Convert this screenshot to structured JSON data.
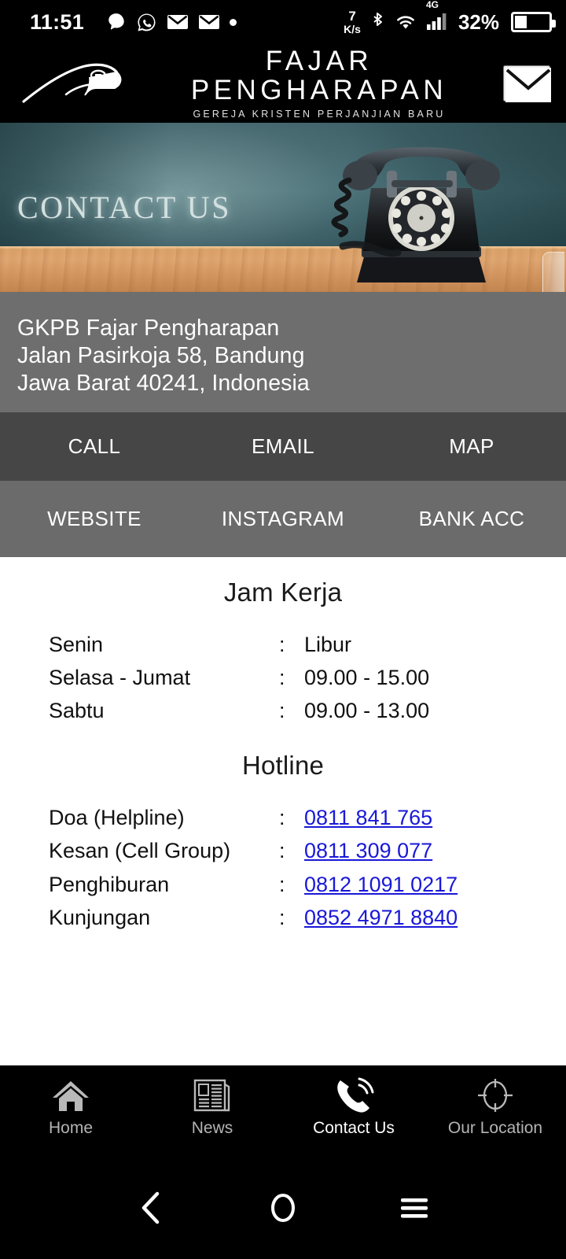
{
  "status_bar": {
    "time": "11:51",
    "icons_left": [
      "chat-bubble-icon",
      "whatsapp-icon",
      "mail-icon",
      "mail-icon",
      "dot-icon"
    ],
    "net_speed_value": "7",
    "net_speed_unit": "K/s",
    "icons_right": [
      "bluetooth-icon",
      "wifi-icon"
    ],
    "mobile_network": "4G",
    "battery_percent": "32%"
  },
  "header": {
    "logo": "eagle-logo",
    "title": "FAJAR PENGHARAPAN",
    "subtitle": "GEREJA KRISTEN PERJANJIAN BARU",
    "mail_icon": "envelope-icon"
  },
  "hero": {
    "title": "CONTACT US",
    "image": "vintage-rotary-telephone-on-wooden-table"
  },
  "address": {
    "line1": "GKPB Fajar Pengharapan",
    "line2": "Jalan Pasirkoja 58, Bandung",
    "line3": "Jawa Barat 40241, Indonesia"
  },
  "actions": {
    "row1": [
      {
        "label": "CALL",
        "name": "call-button"
      },
      {
        "label": "EMAIL",
        "name": "email-button"
      },
      {
        "label": "MAP",
        "name": "map-button"
      }
    ],
    "row2": [
      {
        "label": "WEBSITE",
        "name": "website-button"
      },
      {
        "label": "INSTAGRAM",
        "name": "instagram-button"
      },
      {
        "label": "BANK ACC",
        "name": "bank-acc-button"
      }
    ]
  },
  "working_hours": {
    "title": "Jam Kerja",
    "separator": ":",
    "rows": [
      {
        "day": "Senin",
        "hours": "Libur"
      },
      {
        "day": "Selasa - Jumat",
        "hours": "09.00 - 15.00"
      },
      {
        "day": "Sabtu",
        "hours": "09.00 - 13.00"
      }
    ]
  },
  "hotline": {
    "title": "Hotline",
    "separator": ":",
    "rows": [
      {
        "label": "Doa (Helpline)",
        "number": "0811 841 765"
      },
      {
        "label": "Kesan (Cell Group)",
        "number": "0811 309 077"
      },
      {
        "label": "Penghiburan",
        "number": "0812 1091 0217"
      },
      {
        "label": "Kunjungan",
        "number": "0852 4971 8840"
      }
    ]
  },
  "tabbar": {
    "items": [
      {
        "label": "Home",
        "icon": "home-icon",
        "active": false
      },
      {
        "label": "News",
        "icon": "newspaper-icon",
        "active": false
      },
      {
        "label": "Contact Us",
        "icon": "phone-ringing-icon",
        "active": true
      },
      {
        "label": "Our Location",
        "icon": "crosshair-location-icon",
        "active": false
      }
    ]
  },
  "system_nav": {
    "back": "back-chevron-icon",
    "home": "home-circle-icon",
    "menu": "hamburger-menu-icon"
  },
  "colors": {
    "bar_black": "#000000",
    "address_gray": "#6e6e6e",
    "action_row1_gray": "#464646",
    "action_row2_gray": "#6b6b6b",
    "link_blue": "#1a18d8",
    "hero_teal": "#3f6269",
    "table_wood": "#d1935d"
  }
}
